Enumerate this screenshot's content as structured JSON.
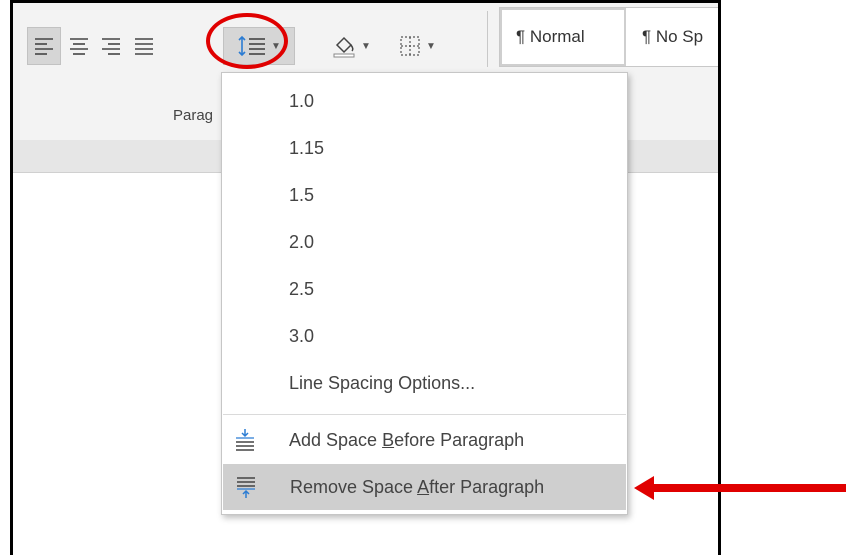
{
  "ribbon": {
    "paragraph_group_label": "Parag",
    "styles": {
      "normal": "¶ Normal",
      "no_spacing": "¶ No Sp"
    }
  },
  "line_spacing_menu": {
    "items": [
      {
        "label": "1.0"
      },
      {
        "label": "1.15"
      },
      {
        "label": "1.5"
      },
      {
        "label": "2.0"
      },
      {
        "label": "2.5"
      },
      {
        "label": "3.0"
      },
      {
        "label": "Line Spacing Options..."
      }
    ],
    "add_space_before": {
      "pre": "Add Space ",
      "key": "B",
      "post": "efore Paragraph"
    },
    "remove_space_after": {
      "pre": "Remove Space ",
      "key": "A",
      "post": "fter Paragraph"
    }
  },
  "colors": {
    "annotation_red": "#e00000",
    "icon_blue": "#2b7cd3",
    "hover_gray": "#cfcfcf"
  }
}
